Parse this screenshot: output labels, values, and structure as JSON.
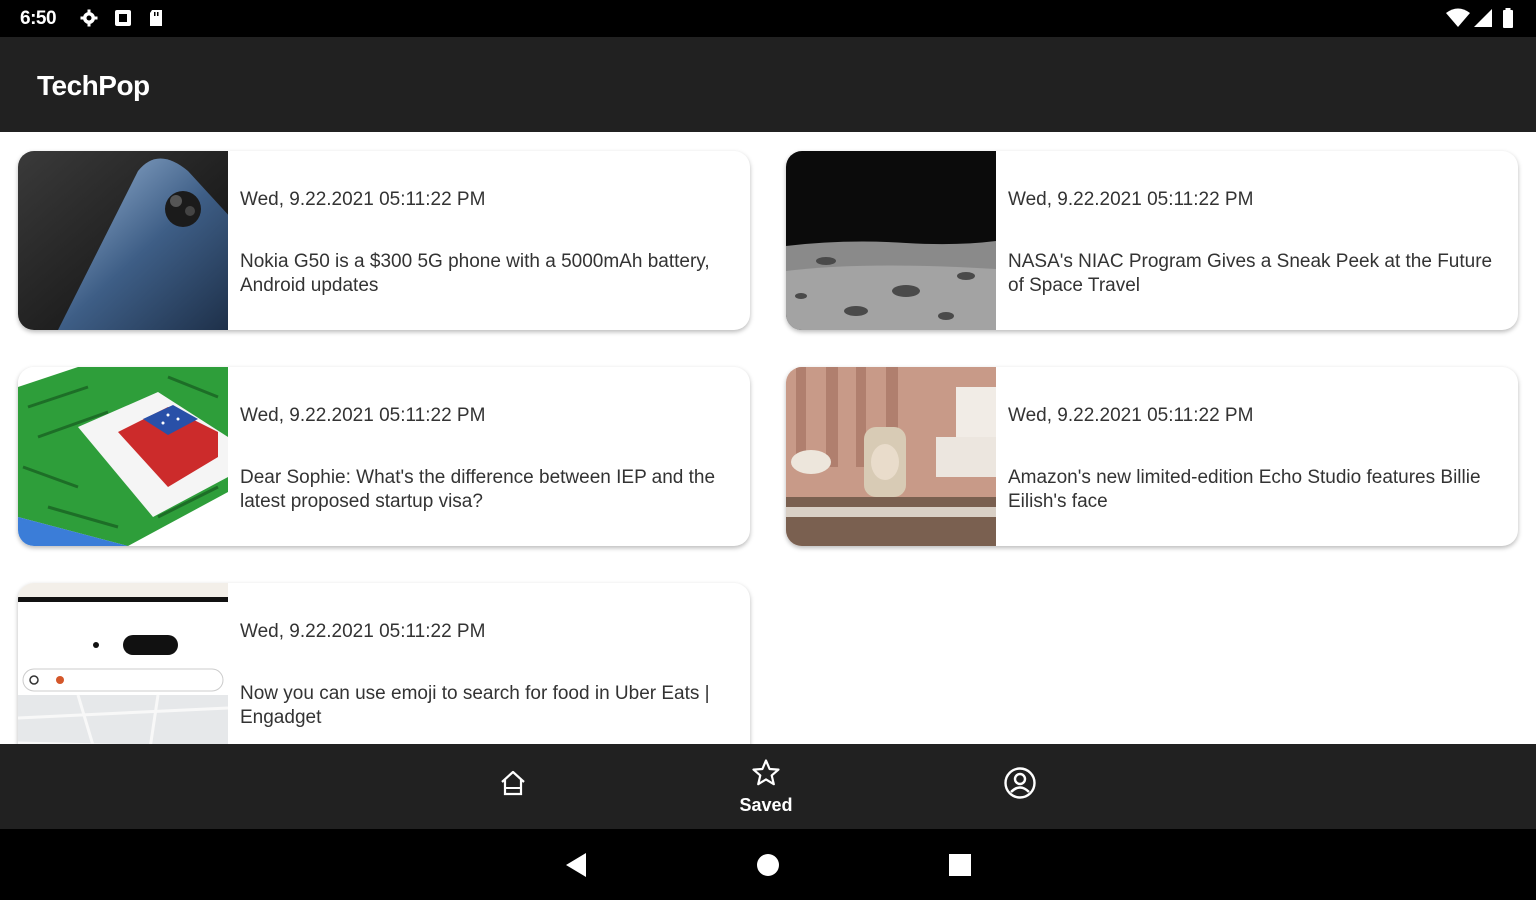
{
  "status_bar": {
    "time": "6:50",
    "icons_left": [
      "settings-icon",
      "notification-icon",
      "sd-card-icon"
    ],
    "icons_right": [
      "wifi-icon",
      "signal-icon",
      "battery-icon"
    ]
  },
  "app_bar": {
    "title": "TechPop"
  },
  "articles": [
    {
      "date": "Wed, 9.22.2021 05:11:22 PM",
      "title": "Nokia G50 is a $300 5G phone with a 5000mAh battery, Android updates",
      "thumb": "phone-image"
    },
    {
      "date": "Wed, 9.22.2021 05:11:22 PM",
      "title": "NASA's NIAC Program Gives a Sneak Peek at the Future of Space Travel",
      "thumb": "moon-surface-image"
    },
    {
      "date": "Wed, 9.22.2021 05:11:22 PM",
      "title": "Dear Sophie: What's the difference between IEP and the latest proposed startup visa?",
      "thumb": "maze-flag-image"
    },
    {
      "date": "Wed, 9.22.2021 05:11:22 PM",
      "title": "Amazon's new limited-edition Echo Studio features Billie Eilish's face",
      "thumb": "echo-studio-image"
    },
    {
      "date": "Wed, 9.22.2021 05:11:22 PM",
      "title": "Now you can use emoji to search for food in Uber Eats | Engadget",
      "thumb": "uber-eats-app-image"
    }
  ],
  "bottom_nav": {
    "items": [
      {
        "id": "home",
        "label": "",
        "icon": "home-icon"
      },
      {
        "id": "saved",
        "label": "Saved",
        "icon": "star-icon"
      },
      {
        "id": "profile",
        "label": "",
        "icon": "account-icon"
      }
    ],
    "selected": "saved"
  },
  "system_nav": {
    "buttons": [
      "back-icon",
      "home-circle-icon",
      "recents-icon"
    ]
  },
  "colors": {
    "bar": "#212121",
    "status": "#000000",
    "card_bg": "#ffffff",
    "text": "#333333"
  }
}
